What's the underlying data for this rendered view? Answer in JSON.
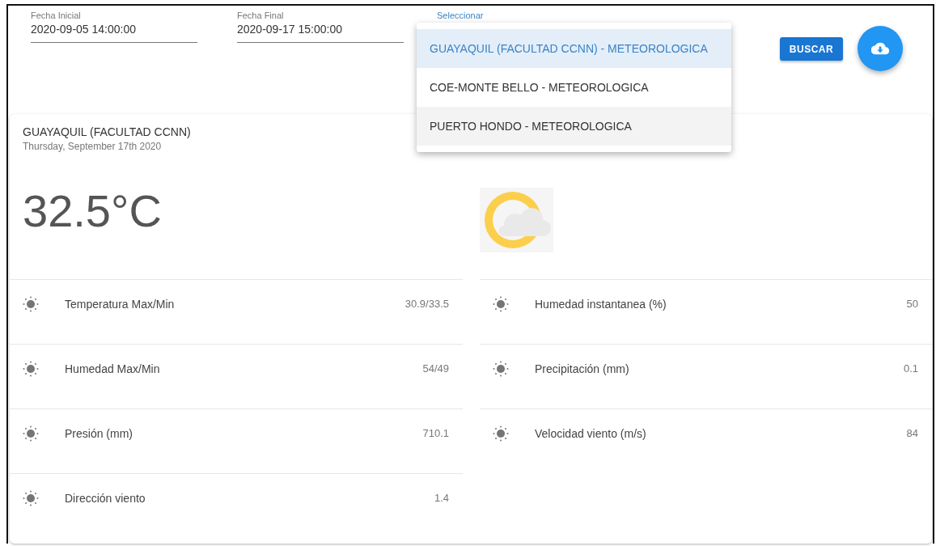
{
  "date_fields": [
    {
      "label": "Fecha Inicial",
      "value": "2020-09-05 14:00:00"
    },
    {
      "label": "Fecha Final",
      "value": "2020-09-17 15:00:00"
    }
  ],
  "station_select": {
    "label": "Seleccionar",
    "options": [
      {
        "label": "GUAYAQUIL (FACULTAD CCNN) - METEOROLOGICA",
        "selected": true,
        "hovered": false
      },
      {
        "label": "COE-MONTE BELLO - METEOROLOGICA",
        "selected": false,
        "hovered": false
      },
      {
        "label": "PUERTO HONDO - METEOROLOGICA",
        "selected": false,
        "hovered": true
      }
    ]
  },
  "search_button": "BUSCAR",
  "station": {
    "name": "GUAYAQUIL (FACULTAD CCNN)",
    "date": "Thursday, September 17th 2020",
    "temperature": "32.5°C"
  },
  "readings_left": [
    {
      "label": "Temperatura Max/Min",
      "value": "30.9/33.5"
    },
    {
      "label": "Humedad Max/Min",
      "value": "54/49"
    },
    {
      "label": "Presión (mm)",
      "value": "710.1"
    },
    {
      "label": "Dirección viento",
      "value": "1.4"
    }
  ],
  "readings_right": [
    {
      "label": "Humedad instantanea (%)",
      "value": "50"
    },
    {
      "label": "Precipitación (mm)",
      "value": "0.1"
    },
    {
      "label": "Velocidad viento (m/s)",
      "value": "84"
    }
  ]
}
